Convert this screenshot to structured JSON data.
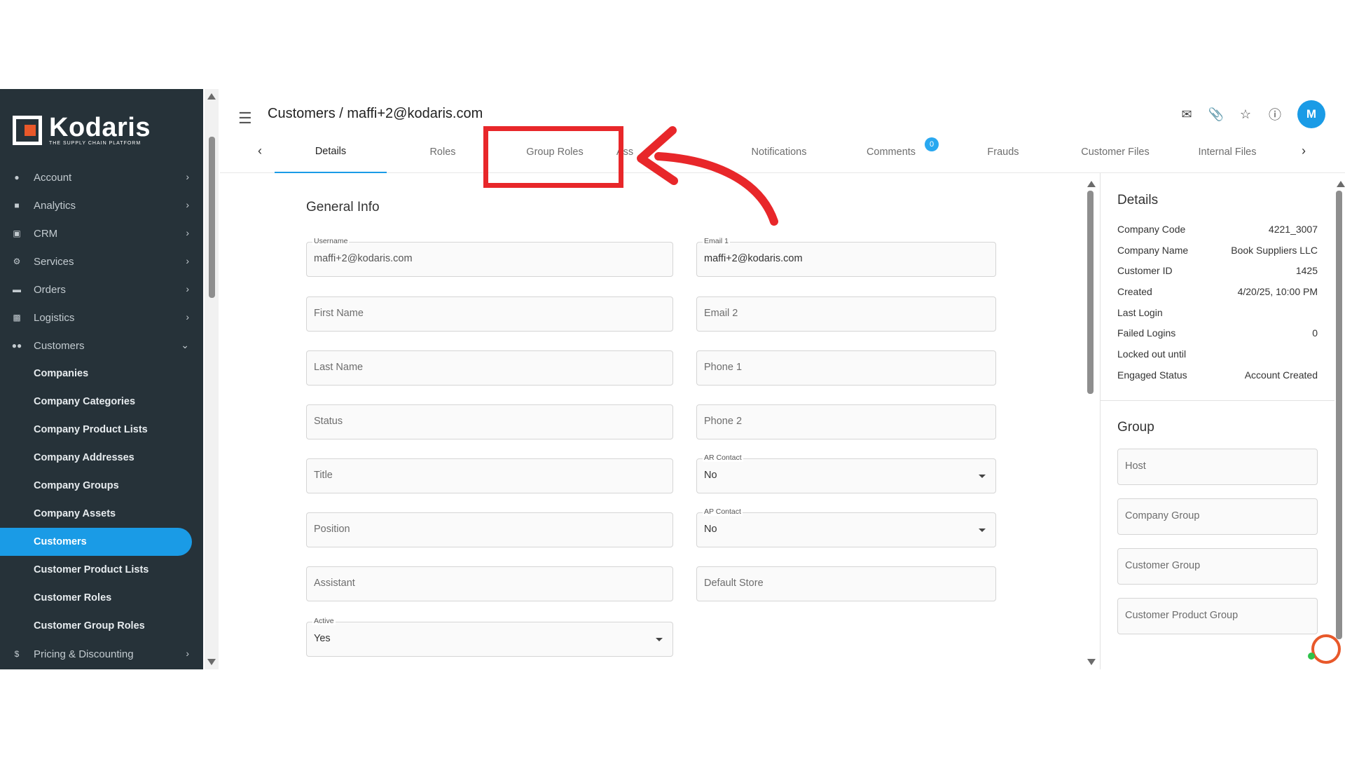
{
  "brand": {
    "name": "Kodaris",
    "tagline": "THE SUPPLY CHAIN PLATFORM"
  },
  "sidebar": {
    "items": [
      {
        "label": "Account",
        "icon": "user-icon"
      },
      {
        "label": "Analytics",
        "icon": "chart-icon"
      },
      {
        "label": "CRM",
        "icon": "id-card-icon"
      },
      {
        "label": "Services",
        "icon": "gears-icon"
      },
      {
        "label": "Orders",
        "icon": "truck-icon"
      },
      {
        "label": "Logistics",
        "icon": "shipping-icon"
      },
      {
        "label": "Customers",
        "icon": "users-icon"
      }
    ],
    "sub_items": [
      "Companies",
      "Company Categories",
      "Company Product Lists",
      "Company Addresses",
      "Company Groups",
      "Company Assets",
      "Customers",
      "Customer Product Lists",
      "Customer Roles",
      "Customer Group Roles"
    ],
    "active_sub": "Customers",
    "bottom_item": {
      "label": "Pricing & Discounting",
      "icon": "dollar-icon"
    }
  },
  "header": {
    "title": "Customers / maffi+2@kodaris.com",
    "avatar_initial": "M"
  },
  "tabs": [
    {
      "label": "Details",
      "active": true
    },
    {
      "label": "Roles"
    },
    {
      "label": "Group Roles",
      "highlighted": true
    },
    {
      "label": "Ass"
    },
    {
      "label": "Notifications"
    },
    {
      "label": "Comments",
      "badge": "0"
    },
    {
      "label": "Frauds"
    },
    {
      "label": "Customer Files"
    },
    {
      "label": "Internal Files"
    }
  ],
  "form": {
    "section_title": "General Info",
    "username": {
      "label": "Username",
      "value": "maffi+2@kodaris.com"
    },
    "email1": {
      "label": "Email 1",
      "value": "maffi+2@kodaris.com"
    },
    "first_name": {
      "placeholder": "First Name"
    },
    "email2": {
      "placeholder": "Email 2"
    },
    "last_name": {
      "placeholder": "Last Name"
    },
    "phone1": {
      "placeholder": "Phone 1"
    },
    "status": {
      "placeholder": "Status"
    },
    "phone2": {
      "placeholder": "Phone 2"
    },
    "title": {
      "placeholder": "Title"
    },
    "ar_contact": {
      "label": "AR Contact",
      "value": "No"
    },
    "position": {
      "placeholder": "Position"
    },
    "ap_contact": {
      "label": "AP Contact",
      "value": "No"
    },
    "assistant": {
      "placeholder": "Assistant"
    },
    "default_store": {
      "placeholder": "Default Store"
    },
    "active": {
      "label": "Active",
      "value": "Yes"
    }
  },
  "details_panel": {
    "title": "Details",
    "rows": [
      {
        "key": "Company Code",
        "value": "4221_3007"
      },
      {
        "key": "Company Name",
        "value": "Book Suppliers LLC"
      },
      {
        "key": "Customer ID",
        "value": "1425"
      },
      {
        "key": "Created",
        "value": "4/20/25, 10:00 PM"
      },
      {
        "key": "Last Login",
        "value": ""
      },
      {
        "key": "Failed Logins",
        "value": "0"
      },
      {
        "key": "Locked out until",
        "value": ""
      },
      {
        "key": "Engaged Status",
        "value": "Account Created"
      }
    ],
    "group_title": "Group",
    "group_fields": [
      "Host",
      "Company Group",
      "Customer Group",
      "Customer Product Group"
    ]
  },
  "annotation_color": "#e8272a",
  "accent_color": "#1a9be6"
}
